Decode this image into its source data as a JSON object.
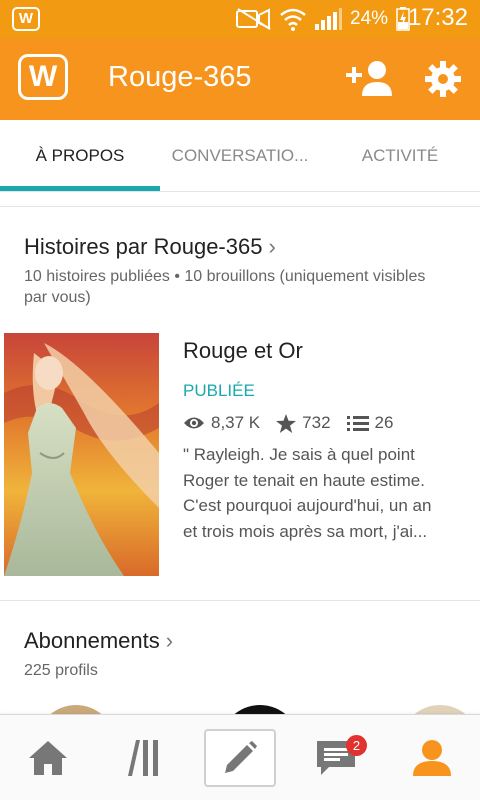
{
  "status_bar": {
    "battery_percent": "24%",
    "time": "17:32"
  },
  "app_bar": {
    "title": "Rouge-365"
  },
  "tabs": [
    {
      "label": "À PROPOS",
      "active": true
    },
    {
      "label": "CONVERSATIO...",
      "active": false
    },
    {
      "label": "ACTIVITÉ",
      "active": false
    }
  ],
  "stories_section": {
    "title": "Histoires par Rouge-365",
    "summary_line1": "10 histoires publiées • 10 brouillons (uniquement visibles",
    "summary_line2": "par vous)"
  },
  "story": {
    "title": "Rouge et Or",
    "status": "PUBLIÉE",
    "reads": "8,37 K",
    "votes": "732",
    "parts": "26",
    "excerpt_lines": [
      "\" Rayleigh. Je sais à quel point",
      "Roger te tenait en haute estime.",
      "C'est pourquoi aujourd'hui, un an",
      "et trois mois après sa mort, j'ai..."
    ]
  },
  "follows_section": {
    "title": "Abonnements",
    "count": "225 profils"
  },
  "bottom_nav": {
    "messages_badge": "2"
  },
  "colors": {
    "accent_orange": "#f7941d",
    "teal": "#18a9b0",
    "badge_red": "#e0322f"
  },
  "icons": [
    "wattpad-logo-icon",
    "mute-icon",
    "wifi-icon",
    "signal-icon",
    "battery-charging-icon",
    "add-user-icon",
    "settings-gear-icon",
    "chevron-right-icon",
    "eye-icon",
    "star-icon",
    "list-icon",
    "home-icon",
    "library-icon",
    "pencil-icon",
    "messages-icon",
    "profile-icon"
  ]
}
